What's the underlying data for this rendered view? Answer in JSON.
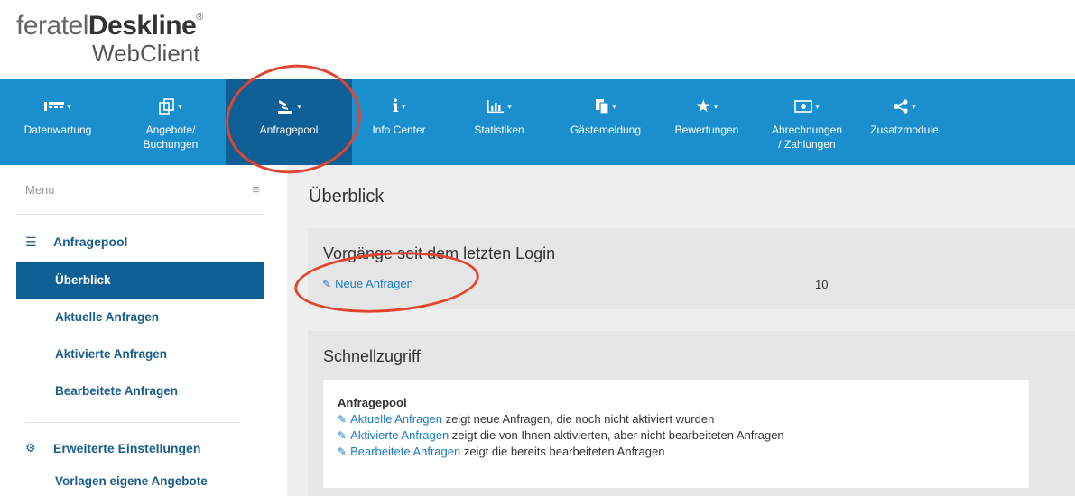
{
  "logo": {
    "brand": "feratel",
    "product": "Deskline",
    "reg": "®",
    "subtitle": "WebClient"
  },
  "nav": {
    "items": [
      {
        "label": "Datenwartung",
        "icon": "calendar-list-icon"
      },
      {
        "label": "Angebote/\nBuchungen",
        "icon": "copy-icon"
      },
      {
        "label": "Anfragepool",
        "icon": "inbox-hand-icon",
        "active": true
      },
      {
        "label": "Info Center",
        "icon": "info-icon"
      },
      {
        "label": "Statistiken",
        "icon": "bar-chart-icon"
      },
      {
        "label": "Gästemeldung",
        "icon": "documents-icon"
      },
      {
        "label": "Bewertungen",
        "icon": "star-icon"
      },
      {
        "label": "Abrechnungen\n/ Zahlungen",
        "icon": "money-icon"
      },
      {
        "label": "Zusatzmodule",
        "icon": "share-icon"
      }
    ]
  },
  "sidebar": {
    "menu_label": "Menu",
    "section1": {
      "title": "Anfragepool",
      "icon": "list-icon",
      "items": [
        "Überblick",
        "Aktuelle Anfragen",
        "Aktivierte Anfragen",
        "Bearbeitete Anfragen"
      ],
      "active_index": 0
    },
    "section2": {
      "title": "Erweiterte Einstellungen",
      "icon": "cogs-icon",
      "items": [
        "Vorlagen eigene Angebote"
      ]
    }
  },
  "main": {
    "title": "Überblick",
    "panel1": {
      "title": "Vorgänge seit dem letzten Login",
      "row_label": "Neue Anfragen",
      "row_value": "10"
    },
    "panel2": {
      "title": "Schnellzugriff",
      "card_title": "Anfragepool",
      "lines": [
        {
          "link": "Aktuelle Anfragen",
          "text": " zeigt neue Anfragen, die noch nicht aktiviert wurden"
        },
        {
          "link": "Aktivierte Anfragen",
          "text": " zeigt die von Ihnen aktivierten, aber nicht bearbeiteten Anfragen"
        },
        {
          "link": "Bearbeitete Anfragen",
          "text": " zeigt die bereits bearbeiteten Anfragen"
        }
      ]
    }
  },
  "colors": {
    "nav_bg": "#1b8fcd",
    "nav_active": "#0d5f96",
    "link": "#1a7bbf",
    "annotation": "#e2452f"
  }
}
